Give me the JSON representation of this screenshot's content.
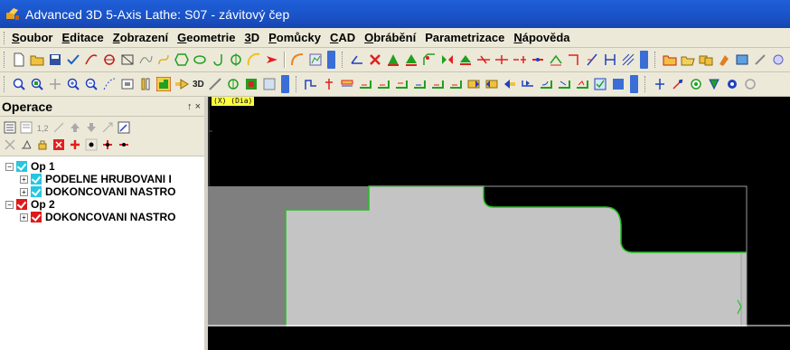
{
  "window": {
    "title": "Advanced 3D 5-Axis Lathe: S07 - závitový čep"
  },
  "menu": {
    "items": [
      {
        "u": "S",
        "rest": "oubor"
      },
      {
        "u": "E",
        "rest": "ditace"
      },
      {
        "u": "Z",
        "rest": "obrazení"
      },
      {
        "u": "G",
        "rest": "eometrie"
      },
      {
        "u": "3",
        "rest": "D"
      },
      {
        "u": "P",
        "rest": "omůcky"
      },
      {
        "u": "C",
        "rest": "AD"
      },
      {
        "u": "O",
        "rest": "brábění"
      },
      {
        "u": "",
        "rest": "Parametrizace"
      },
      {
        "u": "N",
        "rest": "ápověda"
      }
    ]
  },
  "toolbar2": {
    "text_3d": "3D"
  },
  "panel": {
    "title": "Operace",
    "controls": "↑ ×"
  },
  "tree": {
    "nodes": [
      {
        "label": "Op 1"
      },
      {
        "label": "PODELNE HRUBOVANI  I"
      },
      {
        "label": "DOKONCOVANI  NASTRO"
      },
      {
        "label": "Op 2"
      },
      {
        "label": "DOKONCOVANI  NASTRO"
      }
    ]
  },
  "view": {
    "tag": "(X)  (Dia)"
  },
  "colors": {
    "title_bar": "#1a52c6",
    "stock_dark": "#7f7f7f",
    "stock_light": "#c0c0c0",
    "outline_green": "#22c022",
    "background": "#000000"
  }
}
